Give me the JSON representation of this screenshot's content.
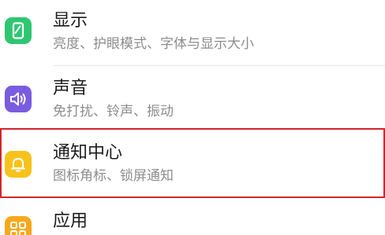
{
  "items": [
    {
      "title": "显示",
      "subtitle": "亮度、护眼模式、字体与显示大小",
      "icon": "display-icon",
      "color": "#2fc672"
    },
    {
      "title": "声音",
      "subtitle": "免打扰、铃声、振动",
      "icon": "speaker-icon",
      "color": "#7a5ce0"
    },
    {
      "title": "通知中心",
      "subtitle": "图标角标、锁屏通知",
      "icon": "bell-icon",
      "color": "#f7c21b"
    },
    {
      "title": "应用",
      "subtitle": "",
      "icon": "apps-grid-icon",
      "color": "#f7a81b"
    }
  ]
}
